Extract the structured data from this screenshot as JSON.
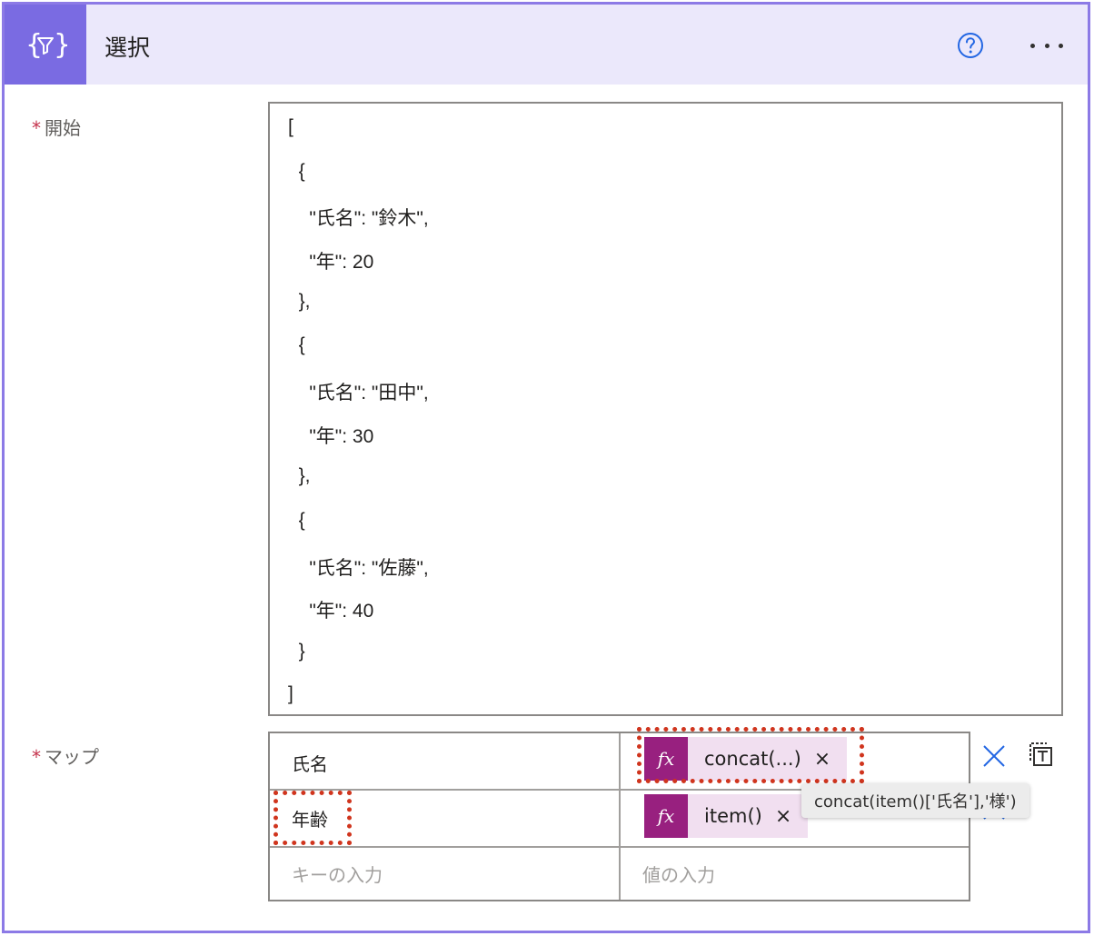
{
  "header": {
    "title": "選択",
    "action_icon": "filter-braces-icon",
    "help_icon": "help-circle-icon",
    "more_icon": "more-ellipsis-icon",
    "accent_color": "#7a6be2",
    "header_bg": "#ebe8fb"
  },
  "from_field": {
    "required_mark": "*",
    "label": "開始",
    "lines": [
      "[",
      "  {",
      "    \"氏名\": \"鈴木\",",
      "    \"年\": 20",
      "  },",
      "  {",
      "    \"氏名\": \"田中\",",
      "    \"年\": 30",
      "  },",
      "  {",
      "    \"氏名\": \"佐藤\",",
      "    \"年\": 40",
      "  }",
      "]"
    ]
  },
  "map_field": {
    "required_mark": "*",
    "label": "マップ",
    "rows": [
      {
        "key": "氏名",
        "value_token": {
          "icon": "fx",
          "label": "concat(...)",
          "close": "×"
        }
      },
      {
        "key": "年齢",
        "value_token": {
          "icon": "fx",
          "label": "item()",
          "close": "×"
        }
      }
    ],
    "key_placeholder": "キーの入力",
    "value_placeholder": "値の入力",
    "token_color": "#98207f",
    "highlight_color": "#d0351e"
  },
  "tooltip": {
    "text": "concat(item()['氏名'],'様')"
  }
}
